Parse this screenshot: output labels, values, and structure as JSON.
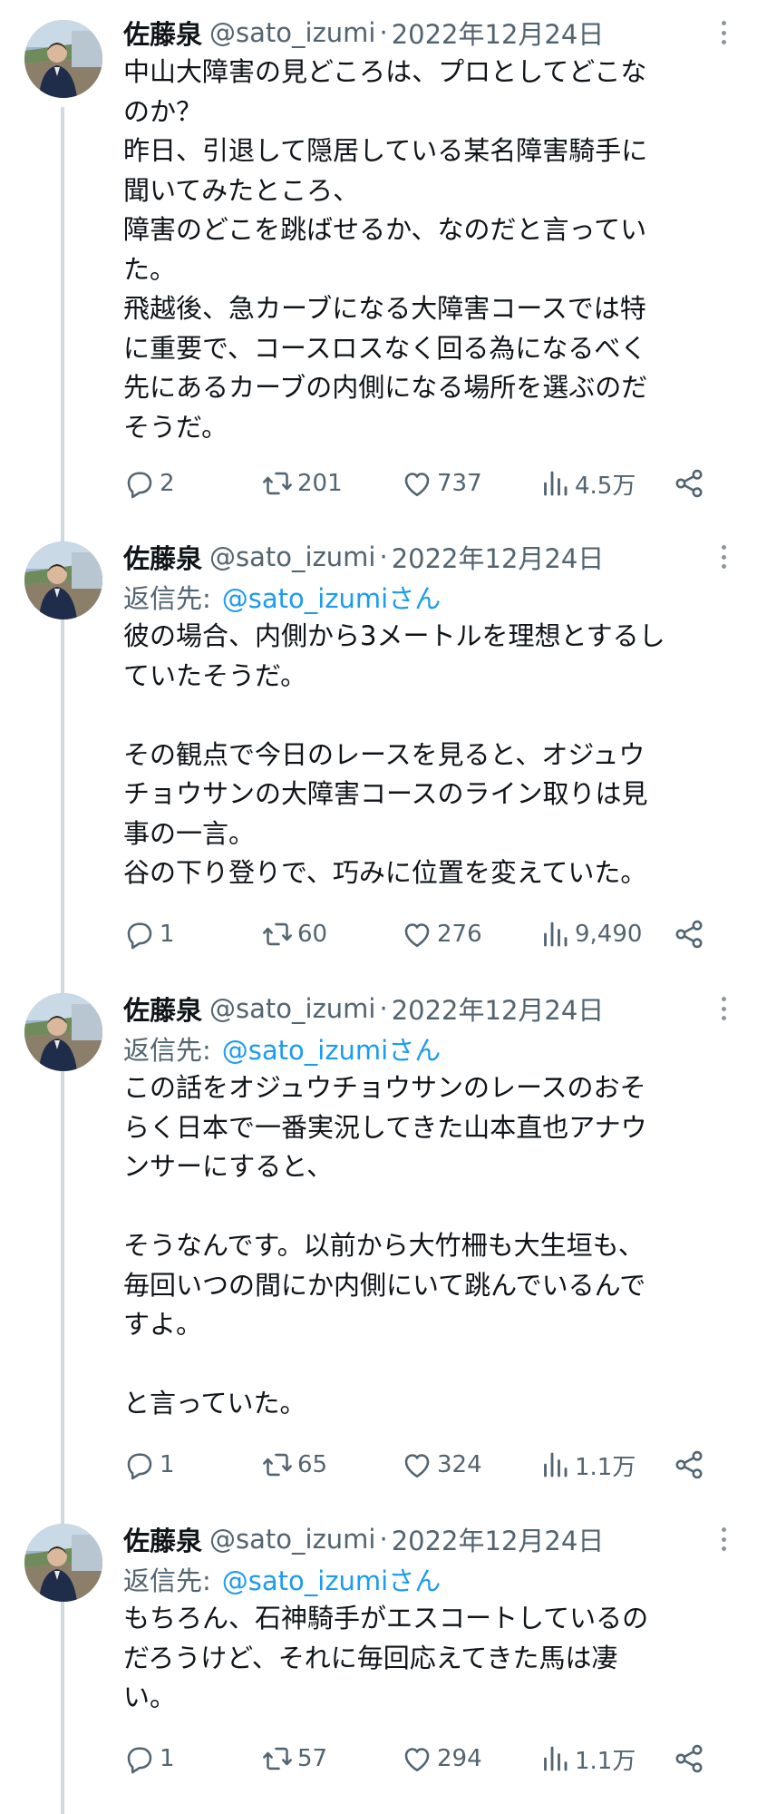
{
  "tweets": [
    {
      "name": "佐藤泉",
      "handle": "@sato_izumi",
      "sep": "·",
      "date": "2022年12月24日",
      "text": "中山大障害の見どころは、プロとしてどこな\nのか？\n昨日、引退して隠居している某名障害騎手に\n聞いてみたところ、\n障害のどこを跳ばせるか、なのだと言ってい\nた。\n飛越後、急カーブになる大障害コースでは特\nに重要で、コースロスなく回る為になるべく\n先にあるカーブの内側になる場所を選ぶのだ\nそうだ。",
      "replies": "2",
      "retweets": "201",
      "likes": "737",
      "views": "4.5万"
    },
    {
      "name": "佐藤泉",
      "handle": "@sato_izumi",
      "sep": "·",
      "date": "2022年12月24日",
      "reply_label": "返信先:",
      "reply_mention": "@sato_izumiさん",
      "text": "彼の場合、内側から3メートルを理想とするし\nていたそうだ。\n\nその観点で今日のレースを見ると、オジュウ\nチョウサンの大障害コースのライン取りは見\n事の一言。\n谷の下り登りで、巧みに位置を変えていた。",
      "replies": "1",
      "retweets": "60",
      "likes": "276",
      "views": "9,490"
    },
    {
      "name": "佐藤泉",
      "handle": "@sato_izumi",
      "sep": "·",
      "date": "2022年12月24日",
      "reply_label": "返信先:",
      "reply_mention": "@sato_izumiさん",
      "text": "この話をオジュウチョウサンのレースのおそ\nらく日本で一番実況してきた山本直也アナウ\nンサーにすると、\n\nそうなんです。以前から大竹柵も大生垣も、\n毎回いつの間にか内側にいて跳んでいるんで\nすよ。\n\nと言っていた。",
      "replies": "1",
      "retweets": "65",
      "likes": "324",
      "views": "1.1万"
    },
    {
      "name": "佐藤泉",
      "handle": "@sato_izumi",
      "sep": "·",
      "date": "2022年12月24日",
      "reply_label": "返信先:",
      "reply_mention": "@sato_izumiさん",
      "text": "もちろん、石神騎手がエスコートしているの\nだろうけど、それに毎回応えてきた馬は凄\nい。",
      "replies": "1",
      "retweets": "57",
      "likes": "294",
      "views": "1.1万"
    }
  ],
  "icons": {
    "reply": "reply-icon",
    "retweet": "retweet-icon",
    "like": "heart-icon",
    "views": "views-icon",
    "share": "share-icon",
    "more": "more-icon"
  },
  "colors": {
    "text": "#0f1419",
    "secondary": "#536471",
    "link": "#1d9bf0",
    "thread_line": "#cfd9de"
  }
}
